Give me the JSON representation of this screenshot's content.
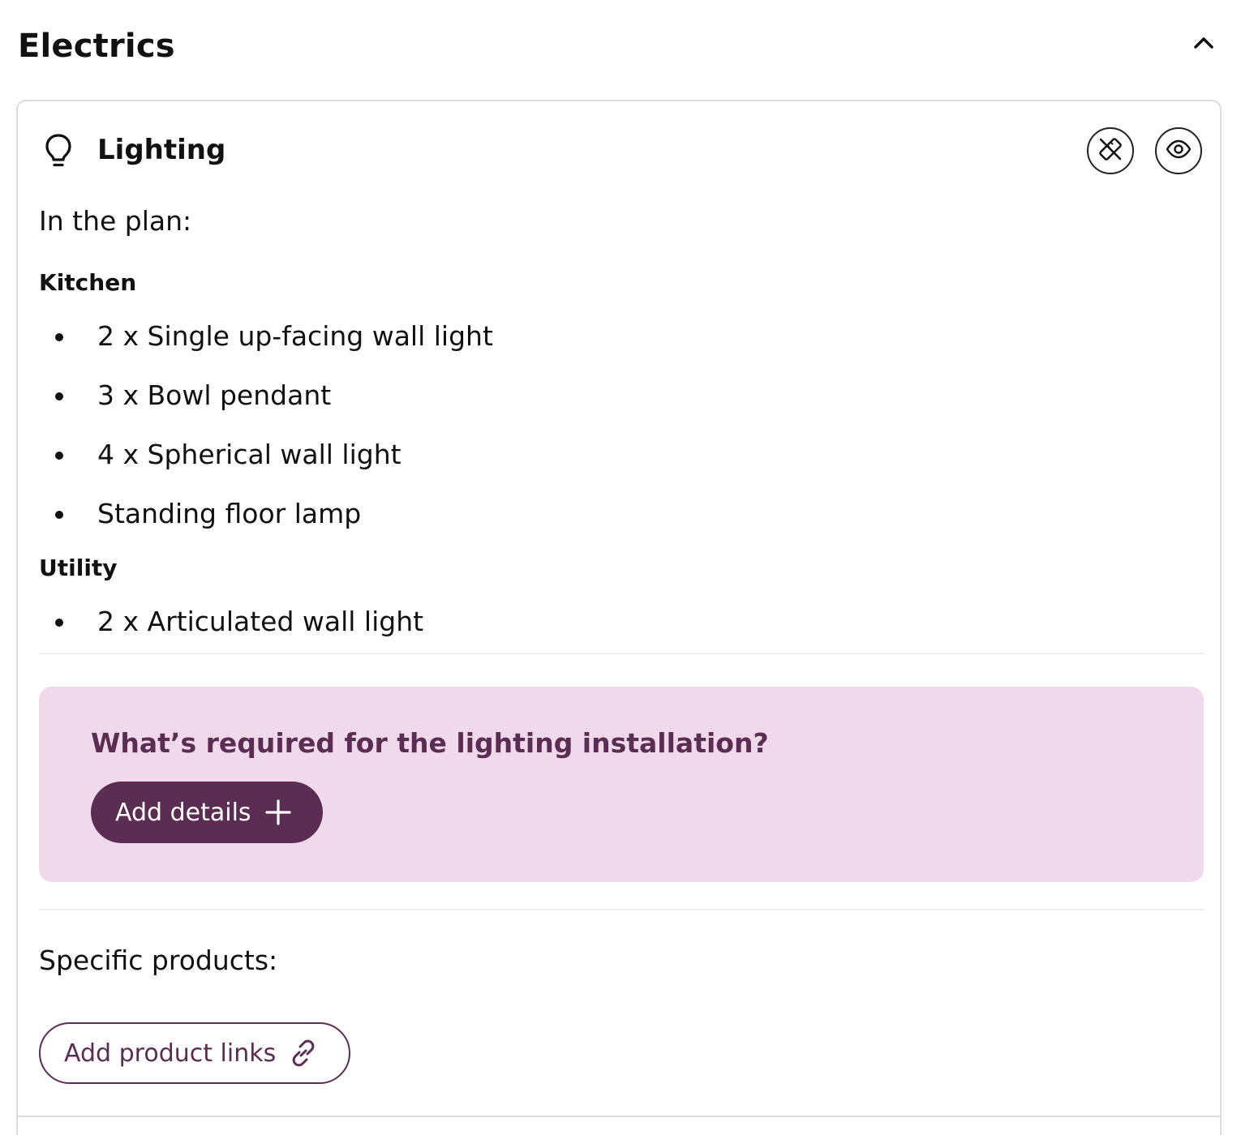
{
  "section": {
    "title": "Electrics",
    "collapse_icon": "chevron-up-icon"
  },
  "card": {
    "icon": "lightbulb-icon",
    "title": "Lighting",
    "actions": [
      {
        "name": "hide-from-plan",
        "icon": "ruler-crossed-icon"
      },
      {
        "name": "view",
        "icon": "eye-icon"
      }
    ],
    "plan_label": "In the plan:",
    "rooms": [
      {
        "name": "Kitchen",
        "items": [
          "2 x Single up-facing wall light",
          "3 x Bowl pendant",
          "4 x Spherical wall light",
          "Standing floor lamp"
        ]
      },
      {
        "name": "Utility",
        "items": [
          "2 x Articulated wall light"
        ]
      }
    ],
    "cta": {
      "question": "What’s required for the lighting installation?",
      "button_label": "Add details",
      "button_icon": "plus-icon"
    },
    "products_label": "Specific products:",
    "links_button_label": "Add product links",
    "links_button_icon": "link-icon"
  },
  "colors": {
    "accent": "#5c2d52",
    "cta_background": "#f1d9ec",
    "border": "#dcdcdc"
  }
}
